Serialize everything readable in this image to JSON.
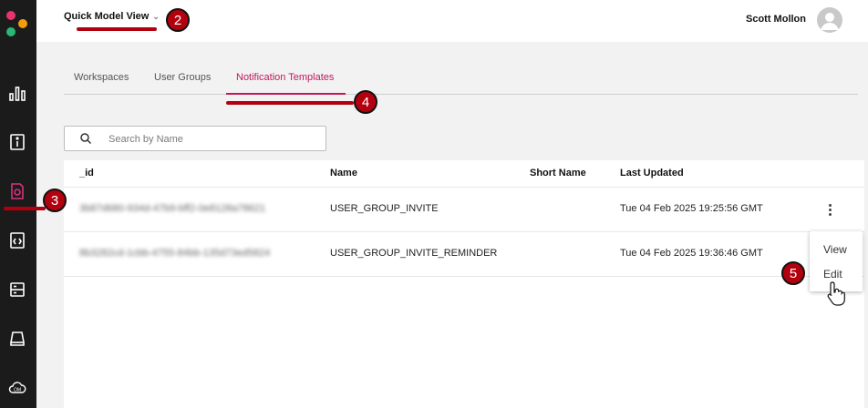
{
  "header": {
    "view_switch_label": "Quick Model View",
    "user_name": "Scott Mollon"
  },
  "tabs": [
    {
      "label": "Workspaces"
    },
    {
      "label": "User Groups"
    },
    {
      "label": "Notification Templates",
      "active": true
    }
  ],
  "search": {
    "placeholder": "Search by Name"
  },
  "table": {
    "columns": [
      "_id",
      "Name",
      "Short Name",
      "Last Updated"
    ],
    "rows": [
      {
        "id": "3b87d680-934d-47b9-bff2-0e8128a78621",
        "name": "USER_GROUP_INVITE",
        "short_name": "",
        "last_updated": "Tue 04 Feb 2025 19:25:56 GMT"
      },
      {
        "id": "8b3282cd-1cbb-4755-84bb-135d73ed5824",
        "name": "USER_GROUP_INVITE_REMINDER",
        "short_name": "",
        "last_updated": "Tue 04 Feb 2025 19:36:46 GMT"
      }
    ]
  },
  "row_menu": {
    "items": [
      "View",
      "Edit"
    ]
  },
  "callouts": {
    "c2": "2",
    "c3": "3",
    "c4": "4",
    "c5": "5"
  },
  "icons": {
    "sidebar": [
      "analytics-icon",
      "info-icon",
      "notification-template-icon",
      "code-icon",
      "list-icon",
      "storage-icon",
      "cloud-om-icon"
    ],
    "cloud_badge_text": "OM"
  },
  "colors": {
    "accent": "#c2185b",
    "callout": "#b3000f",
    "sidebar": "#1b1b1b"
  }
}
